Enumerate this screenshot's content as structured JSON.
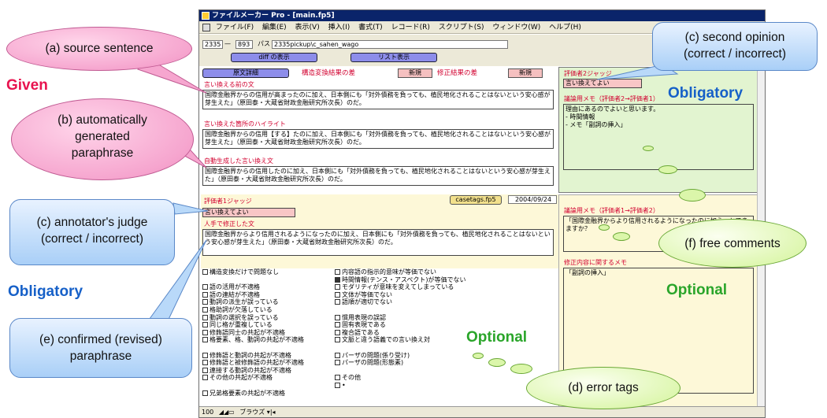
{
  "window": {
    "title": "ファイルメーカー Pro - [main.fp5]",
    "menu": [
      "ファイル(F)",
      "編集(E)",
      "表示(V)",
      "挿入(I)",
      "書式(T)",
      "レコード(R)",
      "スクリプト(S)",
      "ウィンドウ(W)",
      "ヘルプ(H)"
    ]
  },
  "toolbar": {
    "id_from": "2335",
    "dash": "—",
    "id_to": "893",
    "path_label": "パス",
    "path_value": "2335pickup\\c_sahen_wago",
    "diff_button": "diff の表示",
    "list_button": "リスト表示",
    "original_button": "原文詳細",
    "struct_diff_label": "構造変換結果の差",
    "new_button_1": "新規",
    "revise_diff_label": "修正結果の差",
    "new_button_2": "新規"
  },
  "left_panel": {
    "source_label": "言い換える前の文",
    "source_text": "国際金融界からの信用が高まったのに加え、日本側にも「対外債務を負っても、植民地化されることはないという安心感が芽生えた」（原田泰・大蔵省財政金融研究所次長）のだ。",
    "highlight_label": "言い換えた箇所のハイライト",
    "highlight_text": "国際金融界からの信用【する】たのに加え、日本側にも「対外債務を負っても、植民地化されることはないという安心感が芽生えた」（原田泰・大蔵省財政金融研究所次長）のだ。",
    "auto_label": "自動生成した言い換え文",
    "auto_text": "国際金融界からの信用したのに加え、日本側にも「対外債務を負っても、植民地化されることはないという安心感が芽生えた」（原田泰・大蔵省財政金融研究所次長）のだ。",
    "judge1_label": "評価者1ジャッジ",
    "judge1_value": "言い換えてよい",
    "casefile": "casetags.fp5",
    "date": "2004/09/24",
    "revised_label": "人手で修正した文",
    "revised_text": "国際金融界からより信用されるようになったのに加え、日本側にも「対外債務を負っても、植民地化されることはないという安心感が芽生えた」（原田泰・大蔵省財政金融研究所次長）のだ。"
  },
  "right_panel": {
    "judge2_label": "評価者2ジャッジ",
    "judge2_value": "言い換えてよい",
    "memo2_label": "議論用メモ（評価者2→評価者1）",
    "memo2_text": "理由にあるのでよいと思います。\n- 時間情報\n- メモ「副詞の挿入」",
    "memo1_label": "議論用メモ（評価者1→評価者2）",
    "memo1_text": "「国際金融界からより信用されるようになったのに加え」とできますか？",
    "fixmemo_label": "修正内容に関するメモ",
    "fixmemo_text": "「副詞の挿入」"
  },
  "error_tags": {
    "col1": [
      {
        "label": "構造変換だけで問題なし",
        "checked": false
      },
      {
        "label": "",
        "checked": false
      },
      {
        "label": "語の活用が不適格",
        "checked": false
      },
      {
        "label": "語の連結が不適格",
        "checked": false
      },
      {
        "label": "動詞の派生が誤っている",
        "checked": false
      },
      {
        "label": "格助詞が欠落している",
        "checked": false
      },
      {
        "label": "動詞の選択を誤っている",
        "checked": false
      },
      {
        "label": "同じ格が重複している",
        "checked": false
      },
      {
        "label": "修飾語同士の共起が不適格",
        "checked": false
      },
      {
        "label": "格要素、格、動詞の共起が不適格",
        "checked": false
      },
      {
        "label": "",
        "checked": false
      },
      {
        "label": "修飾語と動詞の共起が不適格",
        "checked": false
      },
      {
        "label": "修飾語と被修飾語の共起が不適格",
        "checked": false
      },
      {
        "label": "連接する動詞の共起が不適格",
        "checked": false
      },
      {
        "label": "その他の共起が不適格",
        "checked": false
      },
      {
        "label": "",
        "checked": false
      },
      {
        "label": "兄弟格要素の共起が不適格",
        "checked": false
      }
    ],
    "col2": [
      {
        "label": "内容語の指示的意味が等価でない",
        "checked": false
      },
      {
        "label": "時間情報(テンス・アスペクト)が等価でない",
        "checked": true
      },
      {
        "label": "モダリティが意味を変えてしまっている",
        "checked": false
      },
      {
        "label": "文体が等価でない",
        "checked": false
      },
      {
        "label": "語順が適切でない",
        "checked": false
      },
      {
        "label": "",
        "checked": false
      },
      {
        "label": "慣用表現の誤認",
        "checked": false
      },
      {
        "label": "固有表現である",
        "checked": false
      },
      {
        "label": "複合語である",
        "checked": false
      },
      {
        "label": "文脈と違う語義での言い換え対",
        "checked": false
      },
      {
        "label": "",
        "checked": false
      },
      {
        "label": "パーザの問題(係り受け)",
        "checked": false
      },
      {
        "label": "パーザの問題(形態素)",
        "checked": false
      },
      {
        "label": "",
        "checked": false
      },
      {
        "label": "その他",
        "checked": false
      },
      {
        "label": "•",
        "checked": false
      }
    ]
  },
  "statusbar": {
    "zoom": "100",
    "mode": "ブラウズ"
  },
  "annotations": {
    "source": "(a) source sentence",
    "auto_l1": "(b) automatically",
    "auto_l2": "generated",
    "auto_l3": "paraphrase",
    "judge_l1": "(c) annotator's judge",
    "judge_l2": "(correct / incorrect)",
    "confirmed_l1": "(e) confirmed (revised)",
    "confirmed_l2": "paraphrase",
    "second_l1": "(c) second opinion",
    "second_l2": "(correct / incorrect)",
    "free": "(f) free comments",
    "tags": "(d) error tags",
    "given": "Given",
    "obligatory_left": "Obligatory",
    "obligatory_right": "Obligatory",
    "optional_right": "Optional",
    "optional_mid": "Optional"
  },
  "colors": {
    "given": "#e8134f",
    "obligatory": "#1660c8",
    "optional": "#2aa52a"
  }
}
